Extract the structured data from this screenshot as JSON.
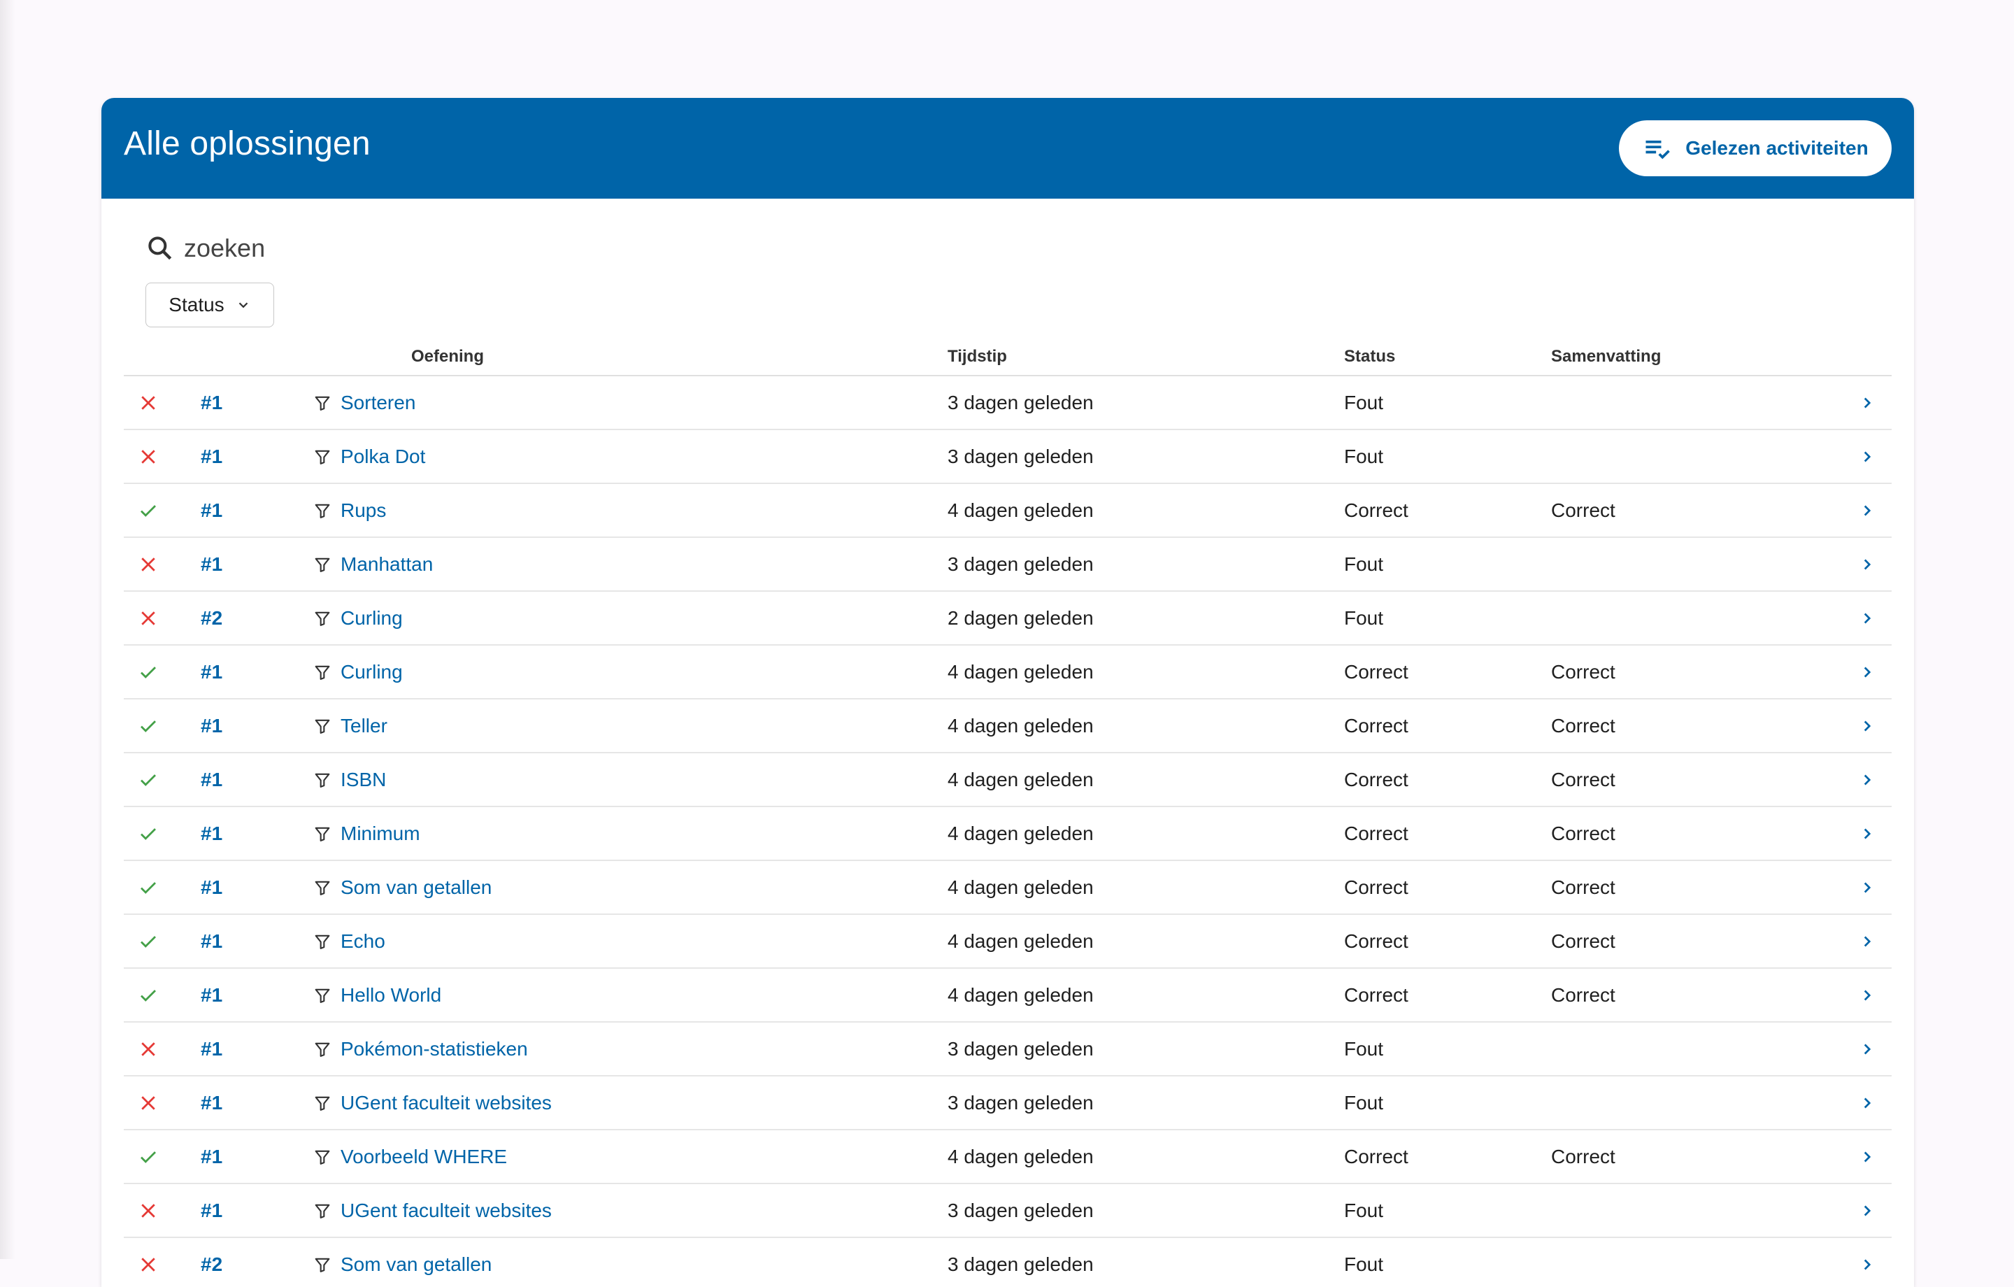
{
  "header": {
    "title": "Alle oplossingen",
    "read_button_label": "Gelezen activiteiten"
  },
  "search": {
    "placeholder": "zoeken"
  },
  "filter": {
    "status_label": "Status"
  },
  "columns": {
    "exercise": "Oefening",
    "time": "Tijdstip",
    "status": "Status",
    "summary": "Samenvatting"
  },
  "colors": {
    "brand": "#0064a8",
    "wrong": "#e53935",
    "correct": "#43a047"
  },
  "rows": [
    {
      "result": "wrong",
      "num": "#1",
      "exercise": "Sorteren",
      "time": "3 dagen geleden",
      "status": "Fout",
      "summary": ""
    },
    {
      "result": "wrong",
      "num": "#1",
      "exercise": "Polka Dot",
      "time": "3 dagen geleden",
      "status": "Fout",
      "summary": ""
    },
    {
      "result": "correct",
      "num": "#1",
      "exercise": "Rups",
      "time": "4 dagen geleden",
      "status": "Correct",
      "summary": "Correct"
    },
    {
      "result": "wrong",
      "num": "#1",
      "exercise": "Manhattan",
      "time": "3 dagen geleden",
      "status": "Fout",
      "summary": ""
    },
    {
      "result": "wrong",
      "num": "#2",
      "exercise": "Curling",
      "time": "2 dagen geleden",
      "status": "Fout",
      "summary": ""
    },
    {
      "result": "correct",
      "num": "#1",
      "exercise": "Curling",
      "time": "4 dagen geleden",
      "status": "Correct",
      "summary": "Correct"
    },
    {
      "result": "correct",
      "num": "#1",
      "exercise": "Teller",
      "time": "4 dagen geleden",
      "status": "Correct",
      "summary": "Correct"
    },
    {
      "result": "correct",
      "num": "#1",
      "exercise": "ISBN",
      "time": "4 dagen geleden",
      "status": "Correct",
      "summary": "Correct"
    },
    {
      "result": "correct",
      "num": "#1",
      "exercise": "Minimum",
      "time": "4 dagen geleden",
      "status": "Correct",
      "summary": "Correct"
    },
    {
      "result": "correct",
      "num": "#1",
      "exercise": "Som van getallen",
      "time": "4 dagen geleden",
      "status": "Correct",
      "summary": "Correct"
    },
    {
      "result": "correct",
      "num": "#1",
      "exercise": "Echo",
      "time": "4 dagen geleden",
      "status": "Correct",
      "summary": "Correct"
    },
    {
      "result": "correct",
      "num": "#1",
      "exercise": "Hello World",
      "time": "4 dagen geleden",
      "status": "Correct",
      "summary": "Correct"
    },
    {
      "result": "wrong",
      "num": "#1",
      "exercise": "Pokémon-statistieken",
      "time": "3 dagen geleden",
      "status": "Fout",
      "summary": ""
    },
    {
      "result": "wrong",
      "num": "#1",
      "exercise": "UGent faculteit websites",
      "time": "3 dagen geleden",
      "status": "Fout",
      "summary": ""
    },
    {
      "result": "correct",
      "num": "#1",
      "exercise": "Voorbeeld WHERE",
      "time": "4 dagen geleden",
      "status": "Correct",
      "summary": "Correct"
    },
    {
      "result": "wrong",
      "num": "#1",
      "exercise": "UGent faculteit websites",
      "time": "3 dagen geleden",
      "status": "Fout",
      "summary": ""
    },
    {
      "result": "wrong",
      "num": "#2",
      "exercise": "Som van getallen",
      "time": "3 dagen geleden",
      "status": "Fout",
      "summary": ""
    }
  ]
}
